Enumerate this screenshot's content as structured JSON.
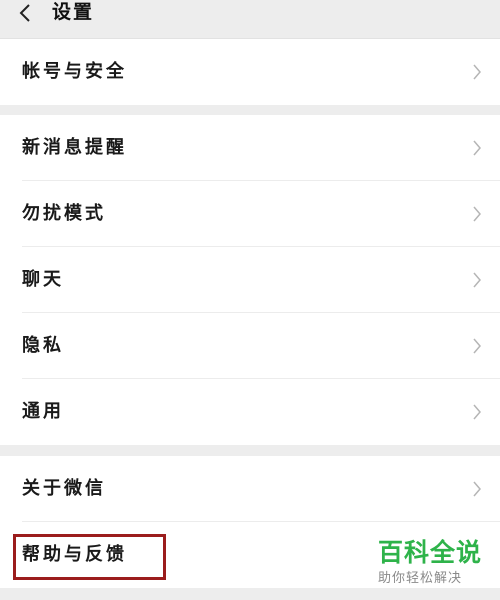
{
  "header": {
    "title": "设置",
    "back_icon": "chevron-left-icon"
  },
  "groups": [
    {
      "items": [
        {
          "label": "帐号与安全"
        }
      ]
    },
    {
      "items": [
        {
          "label": "新消息提醒"
        },
        {
          "label": "勿扰模式"
        },
        {
          "label": "聊天"
        },
        {
          "label": "隐私"
        },
        {
          "label": "通用"
        }
      ]
    },
    {
      "items": [
        {
          "label": "关于微信"
        },
        {
          "label": "帮助与反馈"
        }
      ]
    }
  ],
  "row_icon": "chevron-right-icon",
  "highlight_color": "#9b1d1d",
  "watermark": {
    "main": "百科全说",
    "sub": "助你轻松解决",
    "color": "#2eb34a"
  }
}
